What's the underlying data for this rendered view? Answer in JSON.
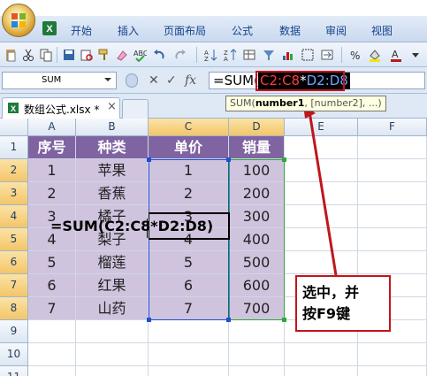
{
  "ribbon": {
    "tabs": [
      "开始",
      "插入",
      "页面布局",
      "公式",
      "数据",
      "审阅",
      "视图"
    ]
  },
  "name_box": {
    "value": "SUM"
  },
  "formula_bar": {
    "prefix": "=SUM(",
    "selected_ref1": "C2:C8",
    "operator": "*",
    "selected_ref2": "D2:D8"
  },
  "workbook_tab": {
    "name": "数组公式.xlsx *",
    "close": "×"
  },
  "tooltip": {
    "func": "SUM(",
    "arg1": "number1",
    "rest": ", [number2], ...)"
  },
  "grid": {
    "columns": [
      "A",
      "B",
      "C",
      "D",
      "E",
      "F"
    ],
    "rows": [
      "1",
      "2",
      "3",
      "4",
      "5",
      "6",
      "7",
      "8",
      "9",
      "10",
      "11"
    ],
    "header": [
      "序号",
      "种类",
      "单价",
      "销量"
    ],
    "data": [
      [
        "1",
        "苹果",
        "1",
        "100"
      ],
      [
        "2",
        "香蕉",
        "2",
        "200"
      ],
      [
        "3",
        "橘子",
        "3",
        "300"
      ],
      [
        "4",
        "梨子",
        "4",
        "400"
      ],
      [
        "5",
        "榴莲",
        "5",
        "500"
      ],
      [
        "6",
        "红果",
        "6",
        "600"
      ],
      [
        "7",
        "山药",
        "7",
        "700"
      ]
    ],
    "edit_cell": {
      "part1": "=SUM(C2:C8*",
      "part2": "D2:D8)"
    }
  },
  "callout": {
    "line1": "选中，并",
    "line2": "按F9键"
  },
  "colors": {
    "header_fill": "#8064a2",
    "data_fill": "#cfc3dd",
    "callout_border": "#c0161c"
  }
}
